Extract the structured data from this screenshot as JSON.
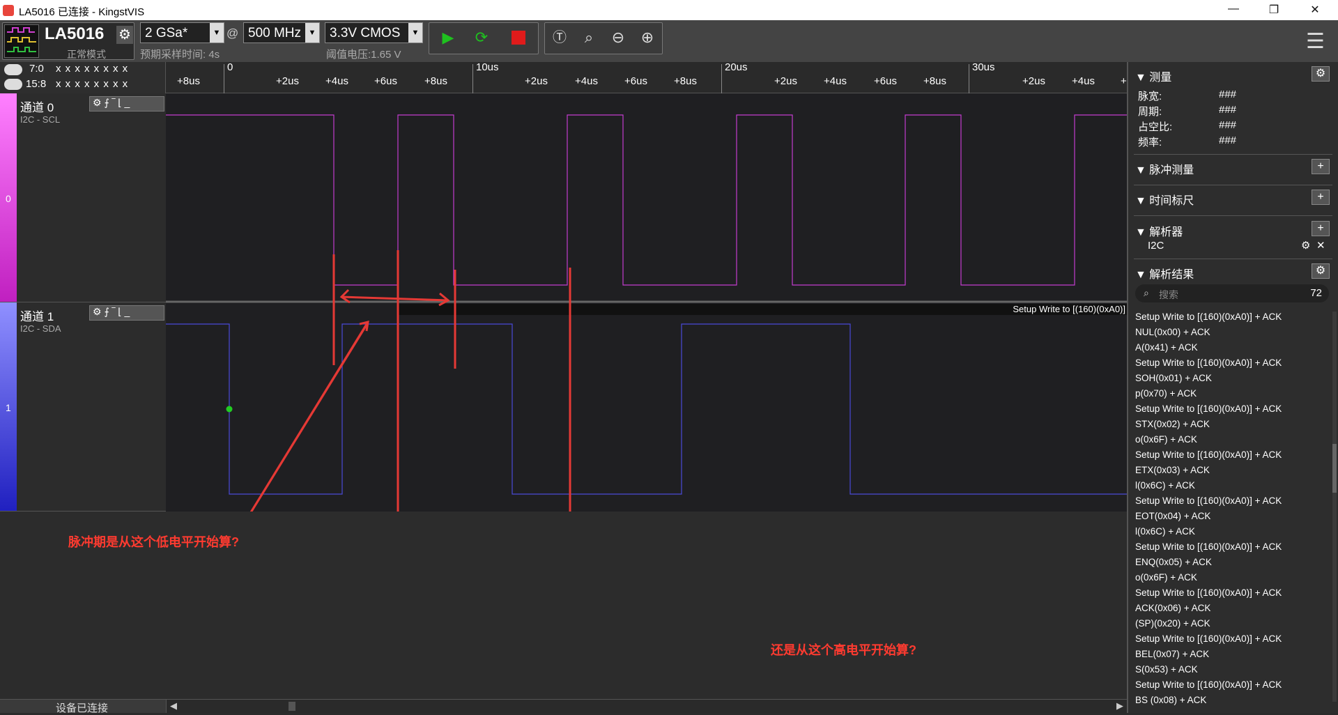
{
  "window": {
    "title": "LA5016 已连接 - KingstVIS",
    "min": "—",
    "max": "❐",
    "close": "✕"
  },
  "toolbar": {
    "device": "LA5016",
    "mode": "正常模式",
    "sample_rate": "2 GSa*",
    "at": "@",
    "frequency": "500 MHz",
    "voltage": "3.3V CMOS",
    "sample_time": "预期采样时间: 4s",
    "threshold": "阈值电压:1.65 V"
  },
  "channel_groups": [
    {
      "label": "7:0",
      "value": "x x x x x x x x"
    },
    {
      "label": "15:8",
      "value": "x x x x x x x x"
    }
  ],
  "ruler": {
    "ticks": [
      "+8us",
      "0",
      "+2us",
      "+4us",
      "+6us",
      "+8us",
      "10us",
      "+2us",
      "+4us",
      "+6us",
      "+8us",
      "20us",
      "+2us",
      "+4us",
      "+6us",
      "+8us",
      "30us",
      "+2us",
      "+4us",
      "+"
    ]
  },
  "channels": [
    {
      "name": "通道 0",
      "sub": "I2C - SCL",
      "num": "0",
      "color": "#c33ccf"
    },
    {
      "name": "通道 1",
      "sub": "I2C - SDA",
      "num": "1",
      "color": "#5050e0"
    }
  ],
  "decode_label": "Setup Write to [(160)(0xA0)]",
  "annotations": {
    "left": "脉冲期是从这个低电平开始算?",
    "right": "还是从这个高电平开始算?"
  },
  "status": {
    "text": "设备已连接"
  },
  "panel": {
    "measure_title": "测量",
    "measures": [
      {
        "label": "脉宽:",
        "value": "###"
      },
      {
        "label": "周期:",
        "value": "###"
      },
      {
        "label": "占空比:",
        "value": "###"
      },
      {
        "label": "频率:",
        "value": "###"
      }
    ],
    "pulse_title": "脉冲测量",
    "time_title": "时间标尺",
    "analyzer_title": "解析器",
    "analyzer_item": "I2C",
    "results_title": "解析结果",
    "search_placeholder": "搜索",
    "search_count": "72",
    "results": [
      "Setup Write to [(160)(0xA0)] + ACK",
      "NUL(0x00) + ACK",
      "A(0x41) + ACK",
      "Setup Write to [(160)(0xA0)] + ACK",
      "SOH(0x01) + ACK",
      "p(0x70) + ACK",
      "Setup Write to [(160)(0xA0)] + ACK",
      "STX(0x02) + ACK",
      "o(0x6F) + ACK",
      "Setup Write to [(160)(0xA0)] + ACK",
      "ETX(0x03) + ACK",
      "l(0x6C) + ACK",
      "Setup Write to [(160)(0xA0)] + ACK",
      "EOT(0x04) + ACK",
      "l(0x6C) + ACK",
      "Setup Write to [(160)(0xA0)] + ACK",
      "ENQ(0x05) + ACK",
      "o(0x6F) + ACK",
      "Setup Write to [(160)(0xA0)] + ACK",
      "ACK(0x06) + ACK",
      "(SP)(0x20) + ACK",
      "Setup Write to [(160)(0xA0)] + ACK",
      "BEL(0x07) + ACK",
      "S(0x53) + ACK",
      "Setup Write to [(160)(0xA0)] + ACK",
      "BS (0x08) + ACK"
    ]
  }
}
